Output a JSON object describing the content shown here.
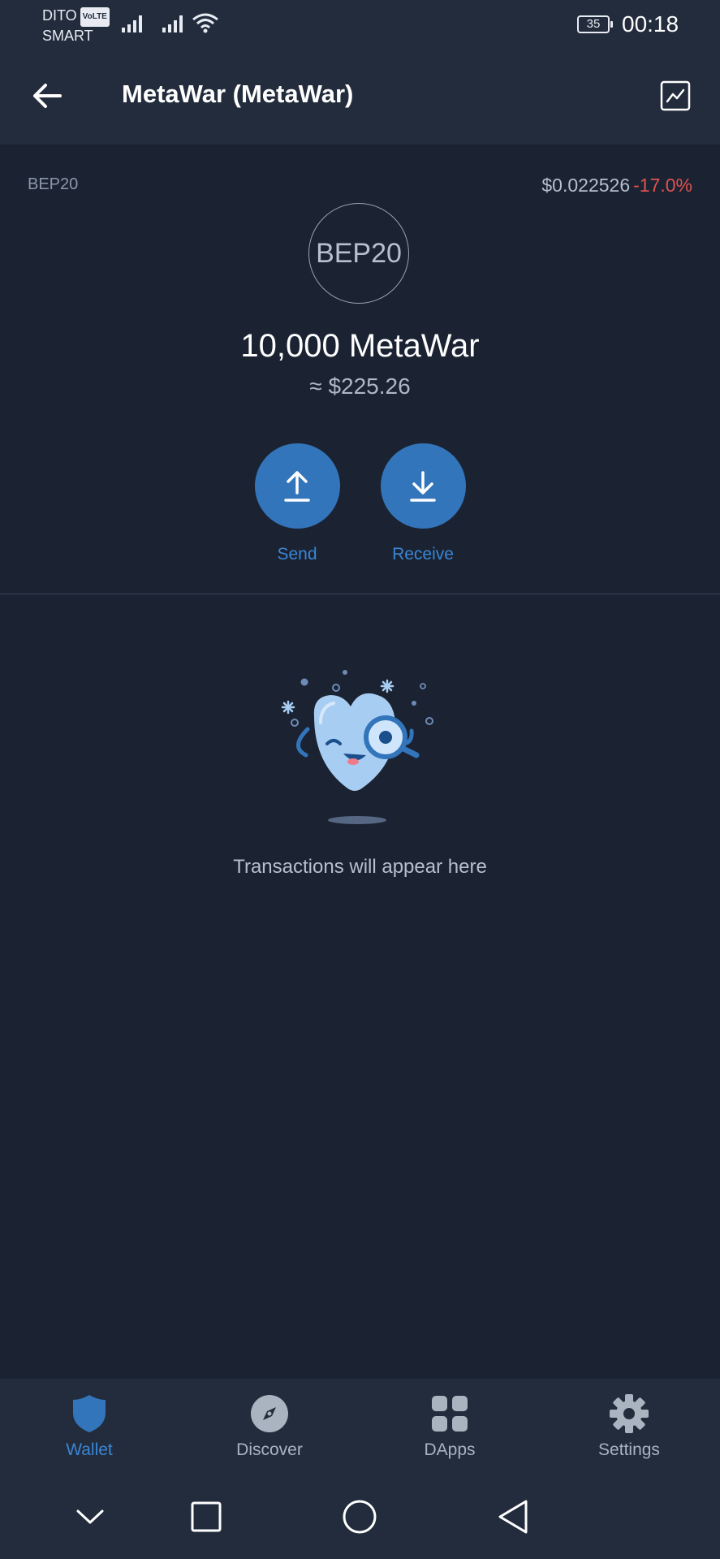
{
  "status_bar": {
    "carrier_line1": "DITO",
    "volte": "VoLTE",
    "carrier_line2": "SMART",
    "battery": "35",
    "time": "00:18"
  },
  "header": {
    "title": "MetaWar (MetaWar)",
    "back_icon": "arrow-left-icon",
    "chart_icon": "price-chart-icon"
  },
  "token": {
    "network": "BEP20",
    "price": "$0.022526",
    "change": "-17.0%",
    "logo_text": "BEP20",
    "balance": "10,000 MetaWar",
    "fiat_value": "≈ $225.26"
  },
  "actions": {
    "send_label": "Send",
    "receive_label": "Receive"
  },
  "empty_state": {
    "text": "Transactions will appear here",
    "illustration_icon": "mascot-magnifier-illustration"
  },
  "tabs": [
    {
      "label": "Wallet",
      "icon": "shield-icon",
      "active": true
    },
    {
      "label": "Discover",
      "icon": "compass-icon",
      "active": false
    },
    {
      "label": "DApps",
      "icon": "grid-icon",
      "active": false
    },
    {
      "label": "Settings",
      "icon": "gear-icon",
      "active": false
    }
  ],
  "colors": {
    "background": "#1b2333",
    "bar": "#222c3c",
    "accent": "#3375bb",
    "negative": "#e0524f"
  }
}
